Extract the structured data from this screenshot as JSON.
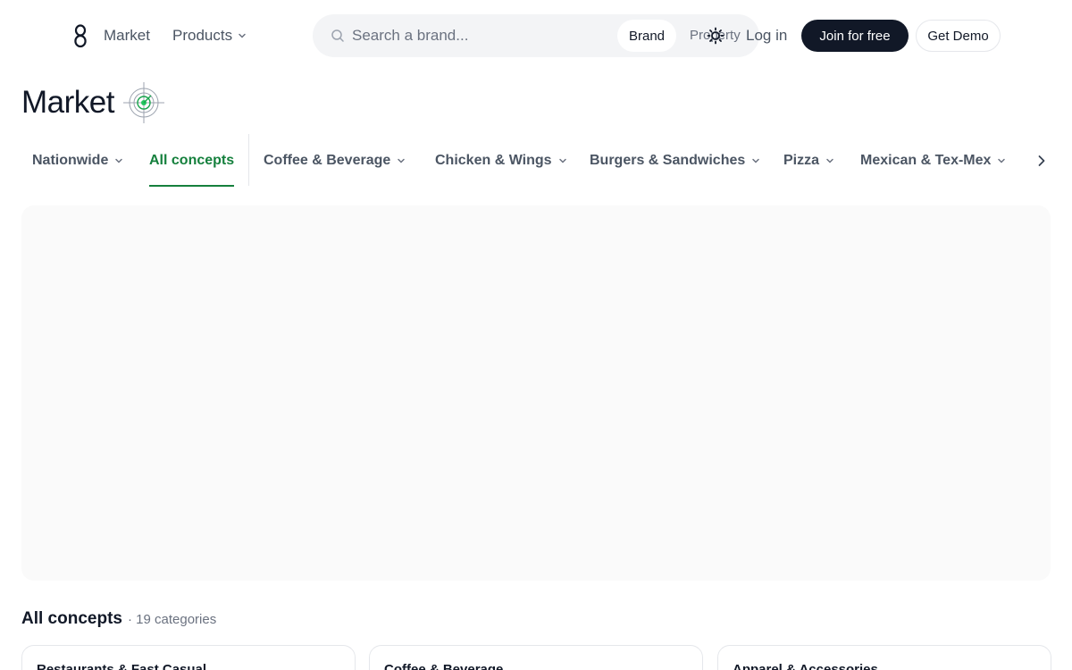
{
  "nav": {
    "market": "Market",
    "products": "Products",
    "search_placeholder": "Search a brand...",
    "search_mode_brand": "Brand",
    "search_mode_property": "Property",
    "login": "Log in",
    "join": "Join for free",
    "demo": "Get Demo"
  },
  "page": {
    "title": "Market"
  },
  "tabs": [
    {
      "label": "Nationwide",
      "has_menu": true
    },
    {
      "label": "All concepts",
      "active": true
    },
    {
      "label": "Coffee & Beverage",
      "has_menu": true
    },
    {
      "label": "Chicken & Wings",
      "has_menu": true
    },
    {
      "label": "Burgers & Sandwiches",
      "has_menu": true
    },
    {
      "label": "Pizza",
      "has_menu": true
    },
    {
      "label": "Mexican & Tex-Mex",
      "has_menu": true
    }
  ],
  "section": {
    "title": "All concepts",
    "count": "· 19 categories"
  },
  "cards": [
    {
      "title": "Restaurants & Fast Casual"
    },
    {
      "title": "Coffee & Beverage"
    },
    {
      "title": "Apparel & Accessories"
    }
  ],
  "colors": {
    "accent": "#15803d",
    "primary_button": "#111827",
    "search_bg": "#f3f4f6",
    "map_bg": "#fafafa"
  },
  "icons": [
    "logo-icon",
    "chevron-down-icon",
    "search-icon",
    "sun-icon",
    "target-icon",
    "chevron-right-icon"
  ]
}
